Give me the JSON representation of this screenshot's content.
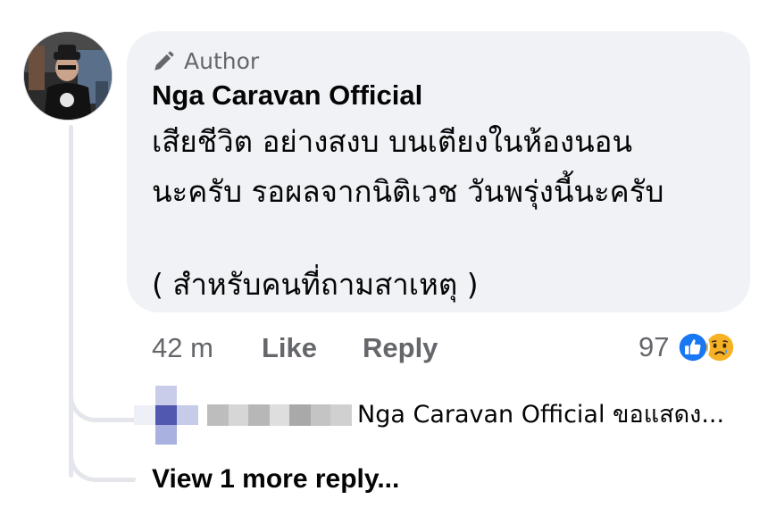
{
  "comment": {
    "author_badge": "Author",
    "author_name": "Nga Caravan Official",
    "lines": [
      "เสียชีวิต อย่างสงบ บนเตียงในห้องนอน",
      "นะครับ รอผลจากนิติเวช วันพรุ่งนี้นะครับ",
      "( สำหรับคนที่ถามสาเหตุ )"
    ],
    "timestamp": "42 m",
    "like_label": "Like",
    "reply_label": "Reply",
    "reaction_count": "97",
    "reactions": [
      "like-icon",
      "sad-icon"
    ]
  },
  "reply_preview": {
    "text": "Nga Caravan Official ขอแสดง..."
  },
  "view_more_label": "View 1 more reply...",
  "colors": {
    "bubble_bg": "#f0f2f5",
    "secondary_text": "#65676b",
    "primary_text": "#050505",
    "like_blue": "#1877f2",
    "thread_line": "#e4e6eb"
  }
}
